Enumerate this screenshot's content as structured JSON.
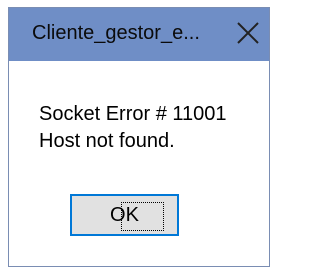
{
  "dialog": {
    "title": "Cliente_gestor_e...",
    "close_icon": "close-icon",
    "message_line1": "Socket Error # 11001",
    "message_line2": "Host not found.",
    "ok_label": "OK"
  },
  "colors": {
    "titlebar": "#6f8ec6",
    "button_border": "#0078d7",
    "button_face": "#e1e1e1"
  }
}
